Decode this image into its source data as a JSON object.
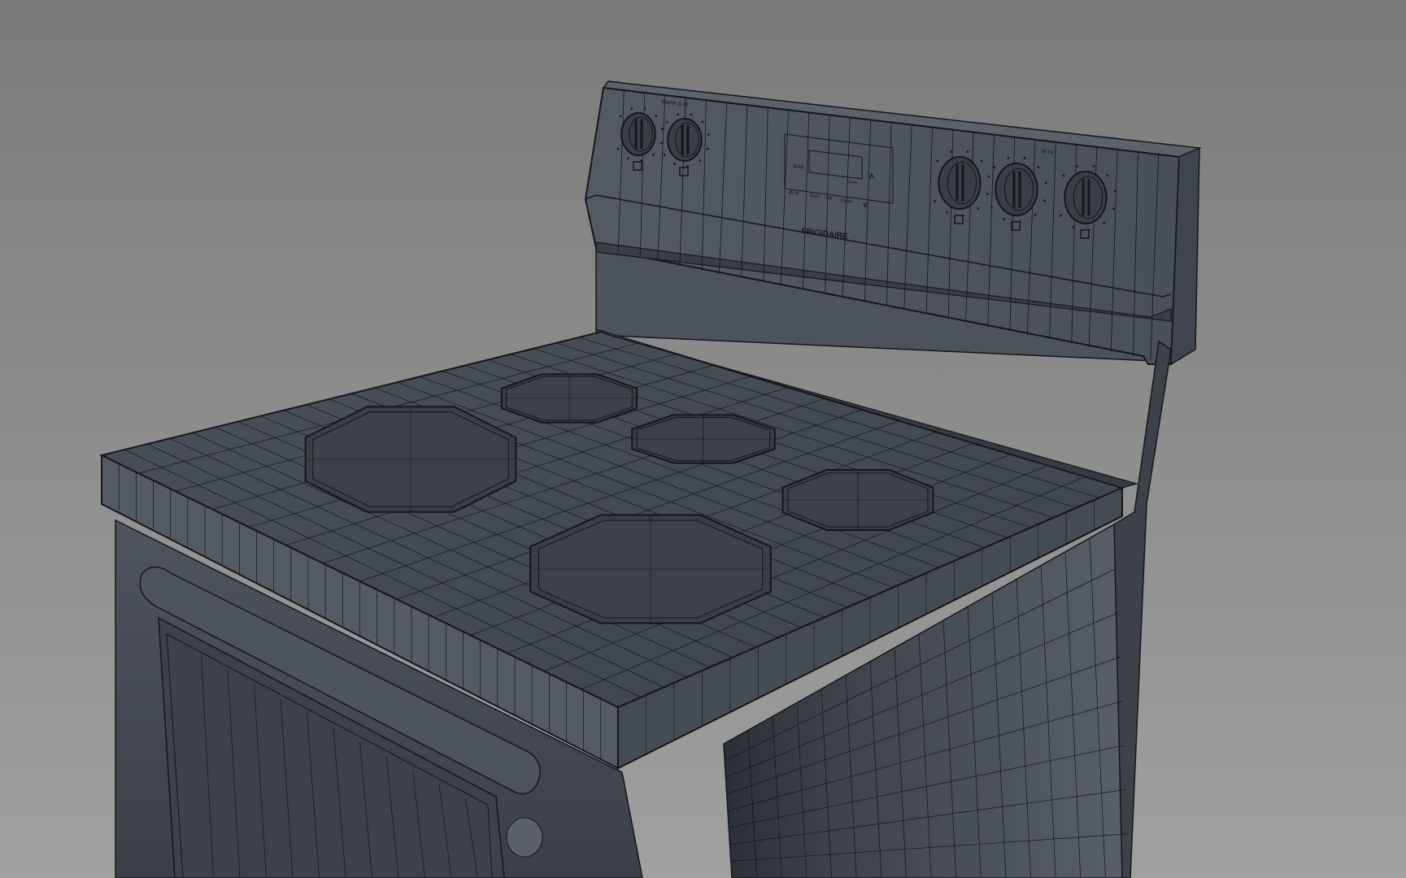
{
  "viewport": {
    "background_top": "#7a7a7a",
    "background_bottom": "#9e9e9e"
  },
  "model": {
    "body_color": "#4a5058",
    "body_dark": "#2f343a",
    "body_light": "#5a6068",
    "wire_color": "#14171b",
    "burner_color": "#3a3f45"
  },
  "control_panel": {
    "brand": "FRIGIDAIRE",
    "left_label": "Warm & Hi",
    "right_label": "Hi Hi",
    "knob_count_left": 2,
    "knob_count_right": 3,
    "display_buttons": [
      "Bake",
      "Broil",
      "Start",
      "Off",
      "Clean",
      "Timer"
    ]
  },
  "cooktop": {
    "burner_count": 5
  }
}
